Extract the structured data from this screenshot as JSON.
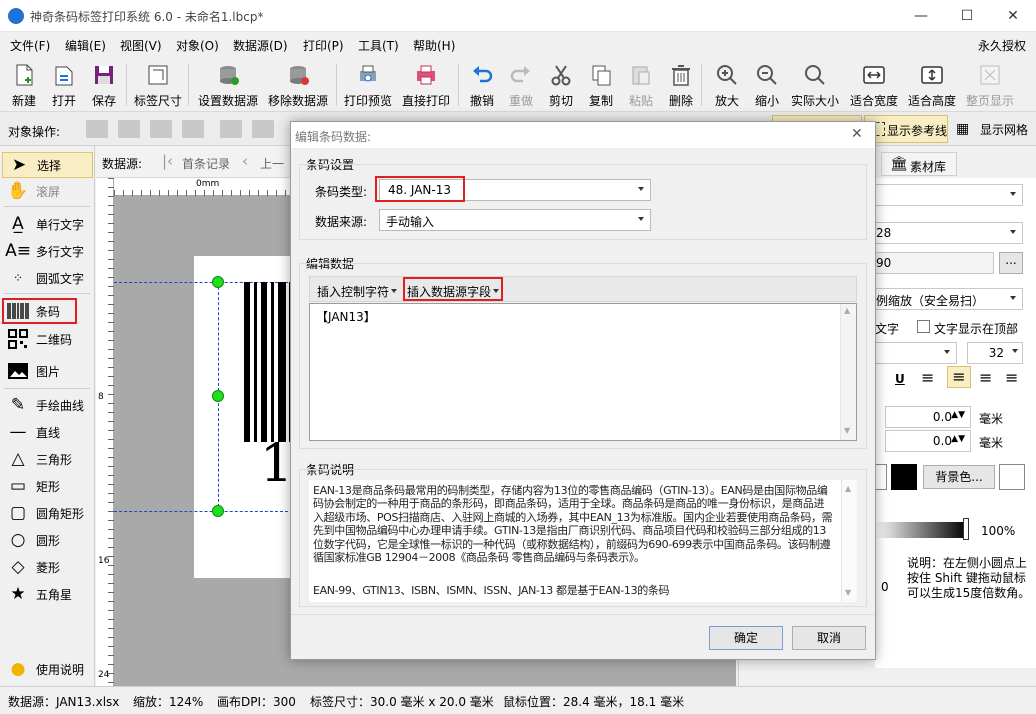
{
  "window": {
    "title": "神奇条码标签打印系统 6.0 - 未命名1.lbcp*",
    "minimize": "—",
    "maximize": "☐",
    "close": "✕"
  },
  "menu": [
    "文件(F)",
    "编辑(E)",
    "视图(V)",
    "对象(O)",
    "数据源(D)",
    "打印(P)",
    "工具(T)",
    "帮助(H)"
  ],
  "menu_right": "永久授权",
  "toolbar": {
    "new": "新建",
    "open": "打开",
    "save": "保存",
    "label_size": "标签尺寸",
    "set_datasource": "设置数据源",
    "remove_datasource": "移除数据源",
    "print_preview": "打印预览",
    "direct_print": "直接打印",
    "undo": "撤销",
    "redo": "重做",
    "cut": "剪切",
    "copy": "复制",
    "paste": "粘贴",
    "delete": "删除",
    "zoom_in": "放大",
    "zoom_out": "缩小",
    "actual_size": "实际大小",
    "fit_width": "适合宽度",
    "fit_height": "适合高度",
    "full_page": "整页显示"
  },
  "objbar": {
    "label": "对象操作:",
    "show_guides": "显示参考线",
    "show_grid": "显示网格"
  },
  "tools": [
    "选择",
    "滚屏",
    "单行文字",
    "多行文字",
    "圆弧文字",
    "条码",
    "二维码",
    "图片",
    "手绘曲线",
    "直线",
    "三角形",
    "矩形",
    "圆角矩形",
    "圆形",
    "菱形",
    "五角星",
    "使用说明"
  ],
  "datasource_bar": {
    "label": "数据源:",
    "first_record": "首条记录",
    "prev": "上一"
  },
  "ruler": {
    "top0": "0mm",
    "l1": "8",
    "l2": "16",
    "l3": "24"
  },
  "label_preview": {
    "digit": "1"
  },
  "right_panel": {
    "tab_material": "素材库",
    "size_value": "28",
    "field2": "90",
    "more": "...",
    "scale_mode": "例缩放（安全易扫）",
    "text_show": "文字",
    "text_on_top": "文字显示在顶部",
    "font_size": "32",
    "underline": "U",
    "val1": "0.0",
    "val2": "0.0",
    "unit": "毫米",
    "bg_color": "背景色...",
    "percent": "100%",
    "hint": "说明：在左侧小圆点上按住 Shift 键拖动鼠标可以生成15度倍数角。",
    "zero": "0"
  },
  "status": {
    "datasource": "数据源：JAN13.xlsx",
    "zoom": "缩放：124%",
    "dpi": "画布DPI：300",
    "label_size": "标签尺寸：30.0 毫米 x 20.0 毫米",
    "mouse": "鼠标位置：28.4 毫米，18.1 毫米"
  },
  "dialog": {
    "title": "编辑条码数据:",
    "close": "✕",
    "barcode_settings": "条码设置",
    "type_label": "条码类型:",
    "type_value": "48. JAN-13",
    "source_label": "数据来源:",
    "source_value": "手动输入",
    "edit_data": "编辑数据",
    "insert_control": "插入控制字符",
    "insert_field": "插入数据源字段",
    "data_value": "【JAN13】",
    "description_title": "条码说明",
    "description": "EAN-13是商品条码最常用的码制类型，存储内容为13位的零售商品编码（GTIN-13）。EAN码是由国际物品编码协会制定的一种用于商品的条形码，即商品条码，适用于全球。商品条码是商品的唯一身份标识，是商品进入超级市场、POS扫描商店、入驻网上商城的入场券，其中EAN_13为标准版。国内企业若要使用商品条码，需先到中国物品编码中心办理申请手续。GTIN-13是指由厂商识别代码、商品项目代码和校验码三部分组成的13位数字代码，它是全球惟一标识的一种代码（或称数据结构），前缀码为690-699表示中国商品条码。该码制遵循国家标准GB 12904－2008《商品条码 零售商品编码与条码表示》。",
    "description2": "EAN-99、GTIN13、ISBN、ISMN、ISSN、JAN-13 都是基于EAN-13的条码",
    "ok": "确定",
    "cancel": "取消"
  },
  "colors": {
    "highlight": "#e02020",
    "handle": "#1ee11e",
    "accent": "#1b74d6"
  }
}
